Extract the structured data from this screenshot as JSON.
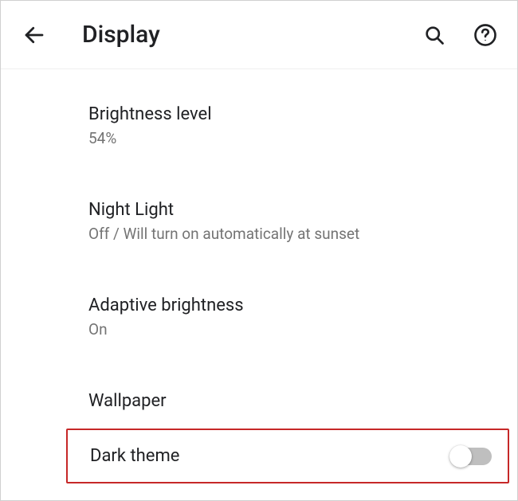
{
  "header": {
    "title": "Display"
  },
  "settings": {
    "brightness": {
      "title": "Brightness level",
      "subtitle": "54%"
    },
    "nightlight": {
      "title": "Night Light",
      "subtitle": "Off / Will turn on automatically at sunset"
    },
    "adaptive": {
      "title": "Adaptive brightness",
      "subtitle": "On"
    },
    "wallpaper": {
      "title": "Wallpaper"
    },
    "darktheme": {
      "title": "Dark theme",
      "enabled": false
    }
  }
}
